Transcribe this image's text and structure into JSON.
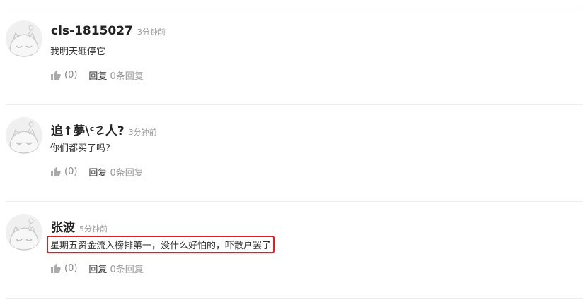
{
  "comments": [
    {
      "username": "cls-1815027",
      "time": "3分钟前",
      "content": "我明天砸停它",
      "likes": "(0)",
      "reply_label": "回复",
      "reply_count": "0条回复",
      "highlighted": false
    },
    {
      "username": "追↑夢\\ᶜ☡人?",
      "time": "3分钟前",
      "content": "你们都买了吗?",
      "likes": "(0)",
      "reply_label": "回复",
      "reply_count": "0条回复",
      "highlighted": false
    },
    {
      "username": "张波",
      "time": "5分钟前",
      "content": "星期五资金流入榜排第一，没什么好怕的，吓散户罢了",
      "likes": "(0)",
      "reply_label": "回复",
      "reply_count": "0条回复",
      "highlighted": true
    }
  ],
  "icons": {
    "avatar": "cat-avatar-icon",
    "like": "thumbs-up-icon"
  },
  "colors": {
    "highlight_border": "#e02020",
    "divider": "#ececec"
  }
}
